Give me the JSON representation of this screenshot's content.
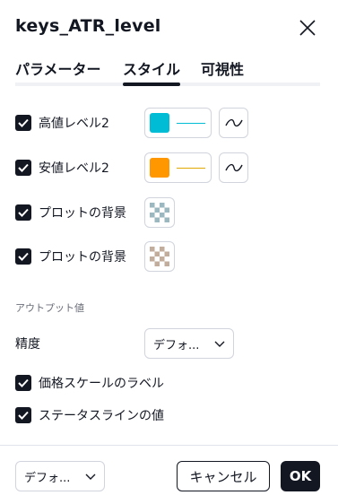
{
  "dialog": {
    "title": "keys_ATR_level"
  },
  "tabs": [
    {
      "label": "パラメーター",
      "active": false
    },
    {
      "label": "スタイル",
      "active": true
    },
    {
      "label": "可視性",
      "active": false
    }
  ],
  "style": {
    "plots": [
      {
        "label": "高値レベル2",
        "checked": true,
        "color": "#00bcd4"
      },
      {
        "label": "安値レベル2",
        "checked": true,
        "color": "#ff9800"
      }
    ],
    "backgrounds": [
      {
        "label": "プロットの背景",
        "checked": true,
        "color": "#9bb7bf"
      },
      {
        "label": "プロットの背景",
        "checked": true,
        "color": "#c2ad9c"
      }
    ]
  },
  "output": {
    "section_title": "アウトプット値",
    "precision_label": "精度",
    "precision_value": "デフォ...",
    "price_scale_label": "価格スケールのラベル",
    "status_line_label": "ステータスラインの値"
  },
  "footer": {
    "defaults_value": "デフォ...",
    "cancel_label": "キャンセル",
    "ok_label": "OK"
  },
  "colors": {
    "accent": "#131722",
    "border": "#d1d4dc"
  }
}
